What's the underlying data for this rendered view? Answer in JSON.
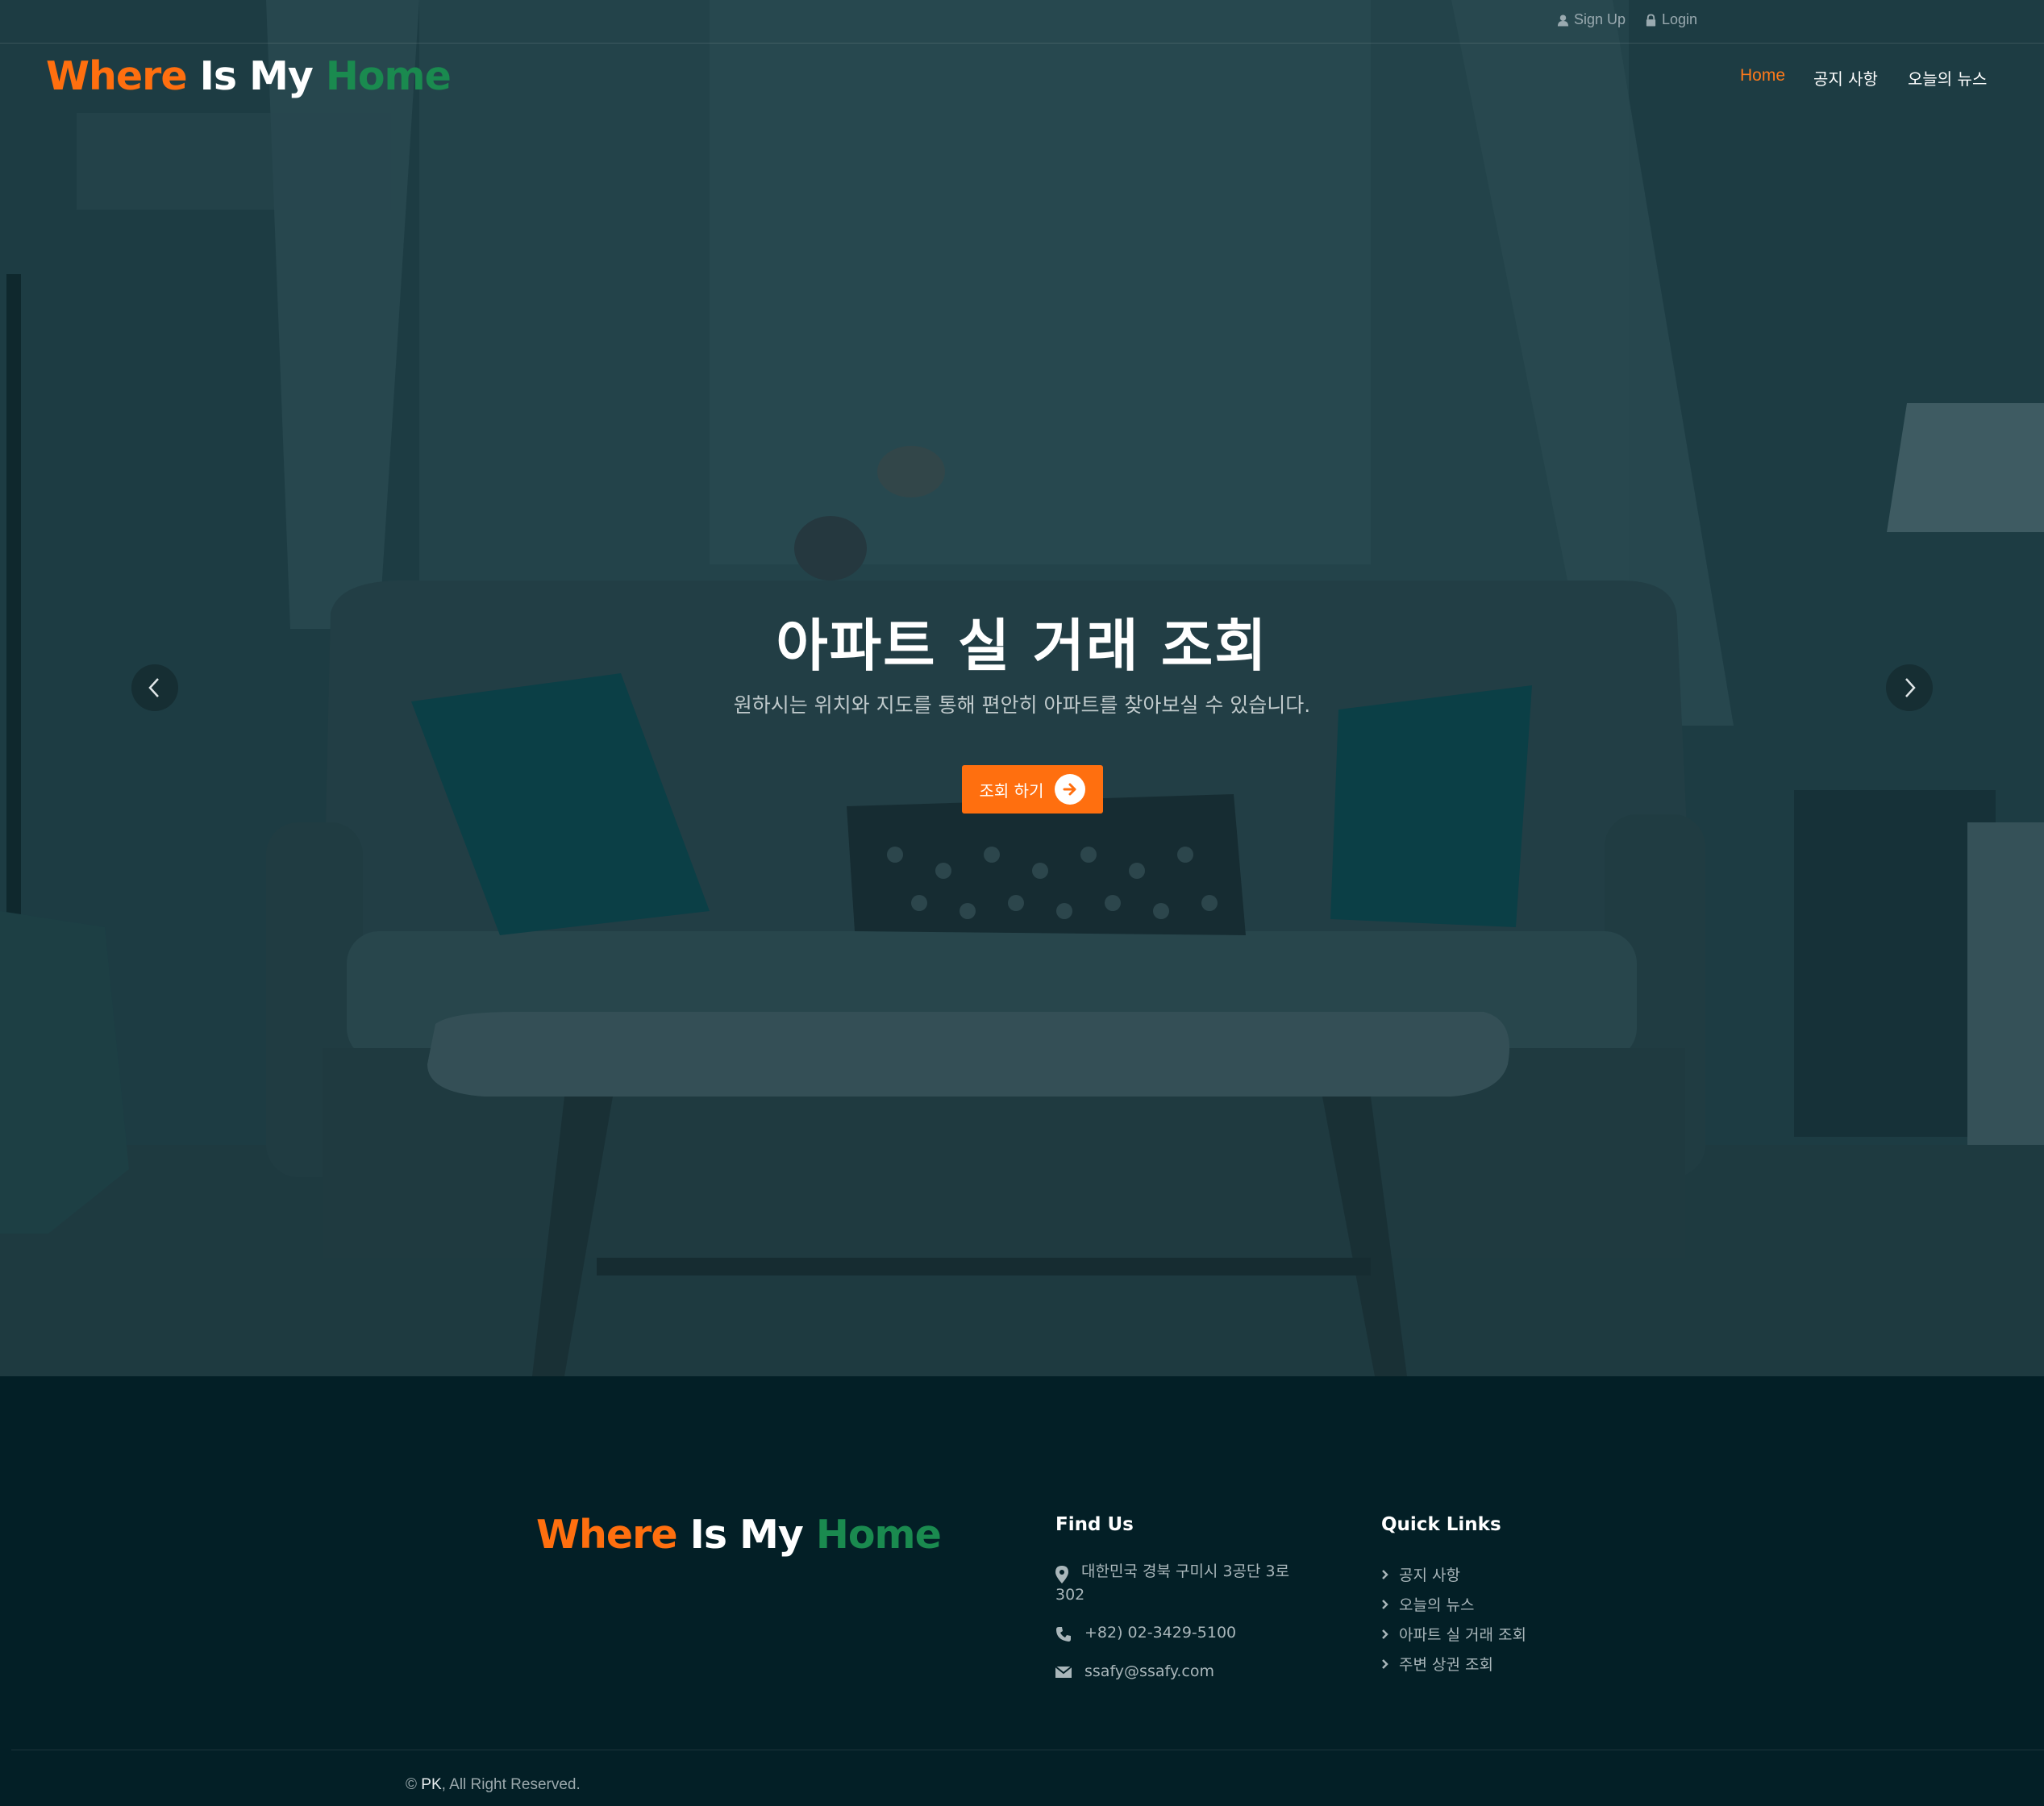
{
  "topbar": {
    "signup_label": "Sign Up",
    "login_label": "Login"
  },
  "brand": {
    "part1": "Where",
    "part2": "Is My",
    "part3": "Home",
    "colors": {
      "orange": "#ff6f0f",
      "white": "#ffffff",
      "green": "#1a8a4f"
    }
  },
  "nav": {
    "items": [
      {
        "label": "Home",
        "active": true
      },
      {
        "label": "공지 사항",
        "active": false
      },
      {
        "label": "오늘의 뉴스",
        "active": false
      }
    ]
  },
  "hero": {
    "title": "아파트 실 거래 조회",
    "subtitle": "원하시는 위치와 지도를 통해 편안히 아파트를 찾아보실 수 있습니다.",
    "button_label": "조회 하기",
    "prev_icon": "chevron-left-icon",
    "next_icon": "chevron-right-icon"
  },
  "footer": {
    "find_us": {
      "heading": "Find Us",
      "address_line1": "대한민국 경북 구미시 3공단 3로",
      "address_line2": "302",
      "phone": "+82) 02-3429-5100",
      "email": "ssafy@ssafy.com"
    },
    "quick_links": {
      "heading": "Quick Links",
      "items": [
        "공지 사항",
        "오늘의 뉴스",
        "아파트 실 거래 조회",
        "주변 상권 조회"
      ]
    },
    "copyright": {
      "symbol": "©",
      "owner": "PK",
      "text": ", All Right Reserved."
    }
  }
}
